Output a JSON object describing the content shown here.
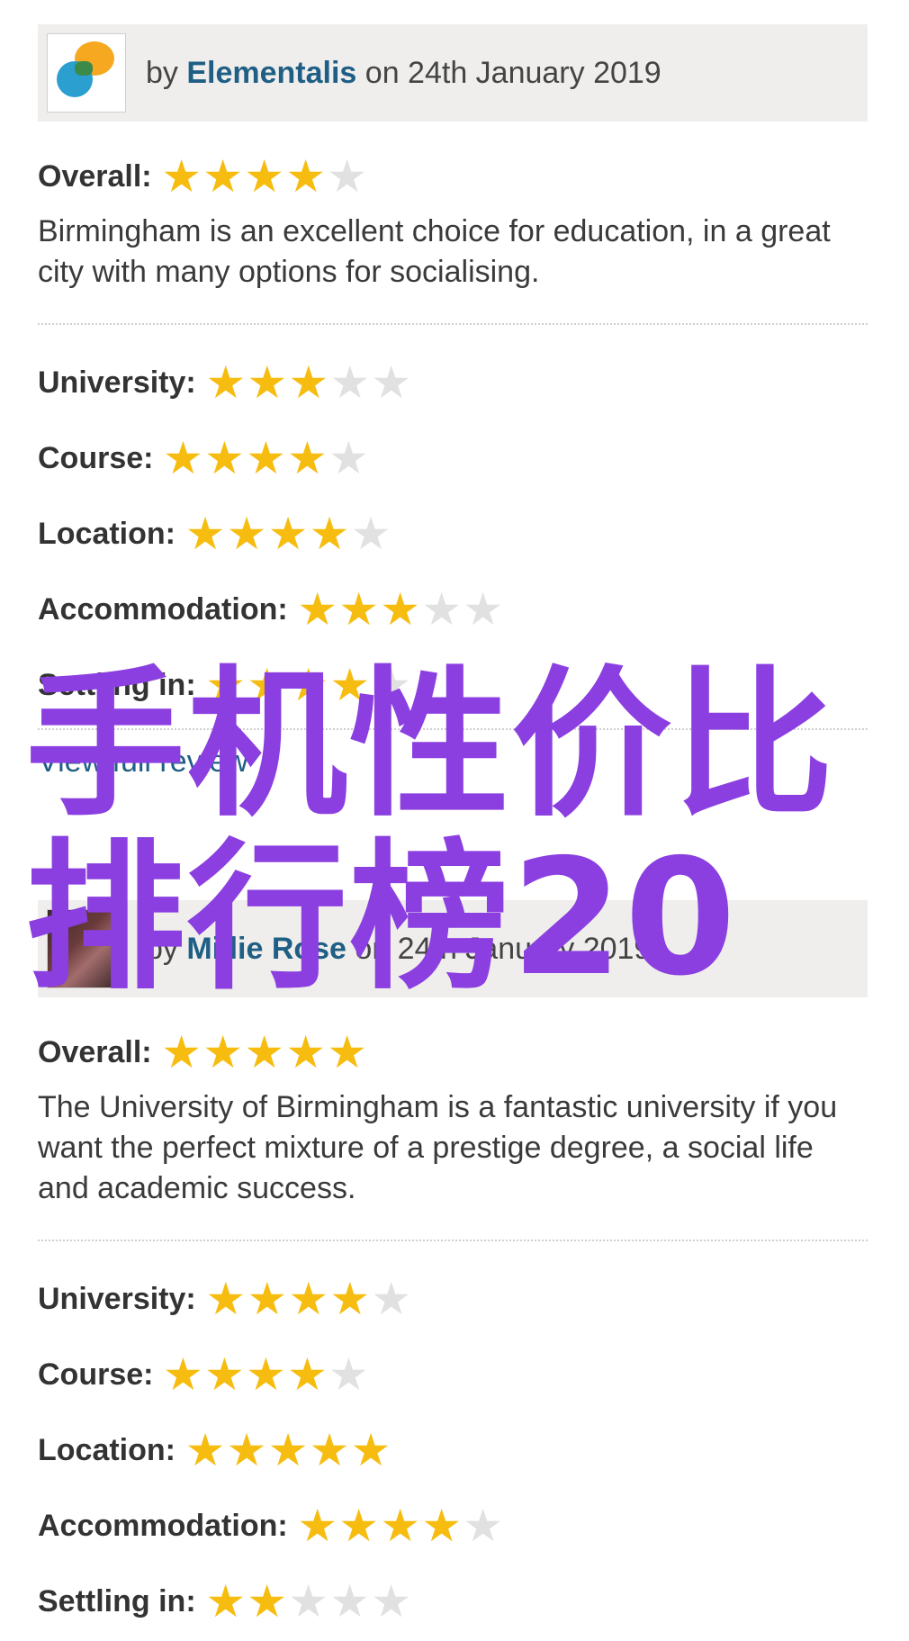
{
  "reviews": [
    {
      "byline_prefix": "by ",
      "author": "Elementalis",
      "byline_suffix": " on 24th January 2019",
      "avatar": "speech-bubbles-logo",
      "overall_label": "Overall:",
      "overall_rating": 4,
      "summary": "Birmingham is an excellent choice for education, in a great city with many options for socialising.",
      "ratings": [
        {
          "label": "University:",
          "value": 3
        },
        {
          "label": "Course:",
          "value": 4
        },
        {
          "label": "Location:",
          "value": 4
        },
        {
          "label": "Accommodation:",
          "value": 3
        },
        {
          "label": "Settling in:",
          "value": 4
        }
      ],
      "view_link": "View full review"
    },
    {
      "byline_prefix": "by ",
      "author": "Millie Rose",
      "byline_suffix": " on 24th January 2019",
      "avatar": "user-photo",
      "overall_label": "Overall:",
      "overall_rating": 5,
      "summary": "The University of Birmingham is a fantastic university if you want the perfect mixture of a prestige degree, a social life and academic success.",
      "ratings": [
        {
          "label": "University:",
          "value": 4
        },
        {
          "label": "Course:",
          "value": 4
        },
        {
          "label": "Location:",
          "value": 5
        },
        {
          "label": "Accommodation:",
          "value": 4
        },
        {
          "label": "Settling in:",
          "value": 2
        }
      ]
    }
  ],
  "overlay": {
    "line1": "手机性价比",
    "line2": "排行榜20",
    "color": "#8b3fe0"
  },
  "colors": {
    "star_on": "#f6bd10",
    "star_off": "#e1e1e1",
    "link": "#1f5f85",
    "header_bg": "#efeeec"
  },
  "max_stars": 5
}
